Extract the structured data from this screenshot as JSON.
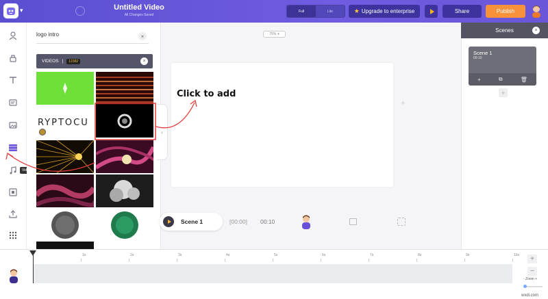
{
  "topbar": {
    "title": "Untitled Video",
    "subtitle": "All Changes Saved",
    "toggle_full": "Full",
    "toggle_lite": "Lite",
    "upgrade_label": "Upgrade to enterprise",
    "share_label": "Share",
    "publish_label": "Publish"
  },
  "rail": {
    "tooltip": "Videos",
    "icons": [
      "character-icon",
      "properties-icon",
      "text-icon",
      "music-note-list-icon",
      "image-icon",
      "video-icon",
      "music-icon",
      "background-icon",
      "upload-icon",
      "more-grid-icon"
    ]
  },
  "search": {
    "query": "logo intro",
    "category_label": "VIDEOS",
    "separator": "|",
    "count": "12392"
  },
  "canvas": {
    "zoom_level": "75%",
    "click_hint": "Click to add"
  },
  "scene_bar": {
    "scene_name": "Scene 1",
    "time_start": "[00:00]",
    "time_end": "00:10"
  },
  "scenes_panel": {
    "title": "Scenes",
    "cards": [
      {
        "name": "Scene 1",
        "duration": "00:10"
      }
    ]
  },
  "timeline": {
    "ticks": [
      "1s",
      "2s",
      "3s",
      "4s",
      "5s",
      "6s",
      "7s",
      "8s",
      "9s",
      "10s"
    ],
    "zoom_label": "- Zoom +"
  },
  "thumbnail_text": "RYPTOCU",
  "watermark": "wxdi.com",
  "colors": {
    "topbar": "#6355d8",
    "publish": "#f7923a",
    "annotation": "#e23b3b",
    "dark_button": "#3e329f"
  }
}
